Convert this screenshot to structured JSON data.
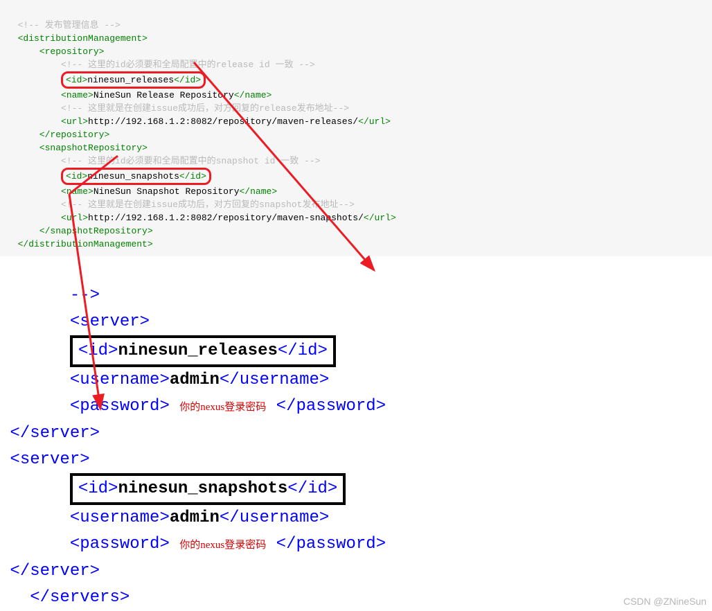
{
  "block1": {
    "comment_top": "!-- 发布管理信息 --",
    "distMgmt_open": "distributionManagement",
    "repository": "repository",
    "comment_release_id": "!-- 这里的id必须要和全局配置中的release id 一致 --",
    "id": "id",
    "ninesun_releases": "ninesun_releases",
    "name": "name",
    "release_repo_name": "NineSun Release Repository",
    "comment_release_url": "!-- 这里就是在创建issue成功后，对方回复的release发布地址--",
    "url": "url",
    "release_url_val": "http://192.168.1.2:8082/repository/maven-releases/",
    "repository_close": "/repository",
    "snapshotRepository": "snapshotRepository",
    "comment_snapshot_id": "!-- 这里的id必须要和全局配置中的snapshot id 一致 --",
    "ninesun_snapshots": "ninesun_snapshots",
    "snapshot_repo_name": "NineSun Snapshot Repository",
    "comment_snapshot_url": "!-- 这里就是在创建issue成功后，对方回复的snapshot发布地址--",
    "snapshot_url_val": "http://192.168.1.2:8082/repository/maven-snapshots/",
    "distMgmt_close": "/distributionManagement"
  },
  "block2": {
    "arrow_stub": "-->",
    "server": "server",
    "id": "id",
    "ninesun_releases": "ninesun_releases",
    "username": "username",
    "admin": "admin",
    "password": "password",
    "hint": "你的nexus登录密码",
    "server_close": "/server",
    "ninesun_snapshots": "ninesun_snapshots",
    "servers_close": "/servers"
  },
  "watermark": "CSDN @ZNineSun"
}
